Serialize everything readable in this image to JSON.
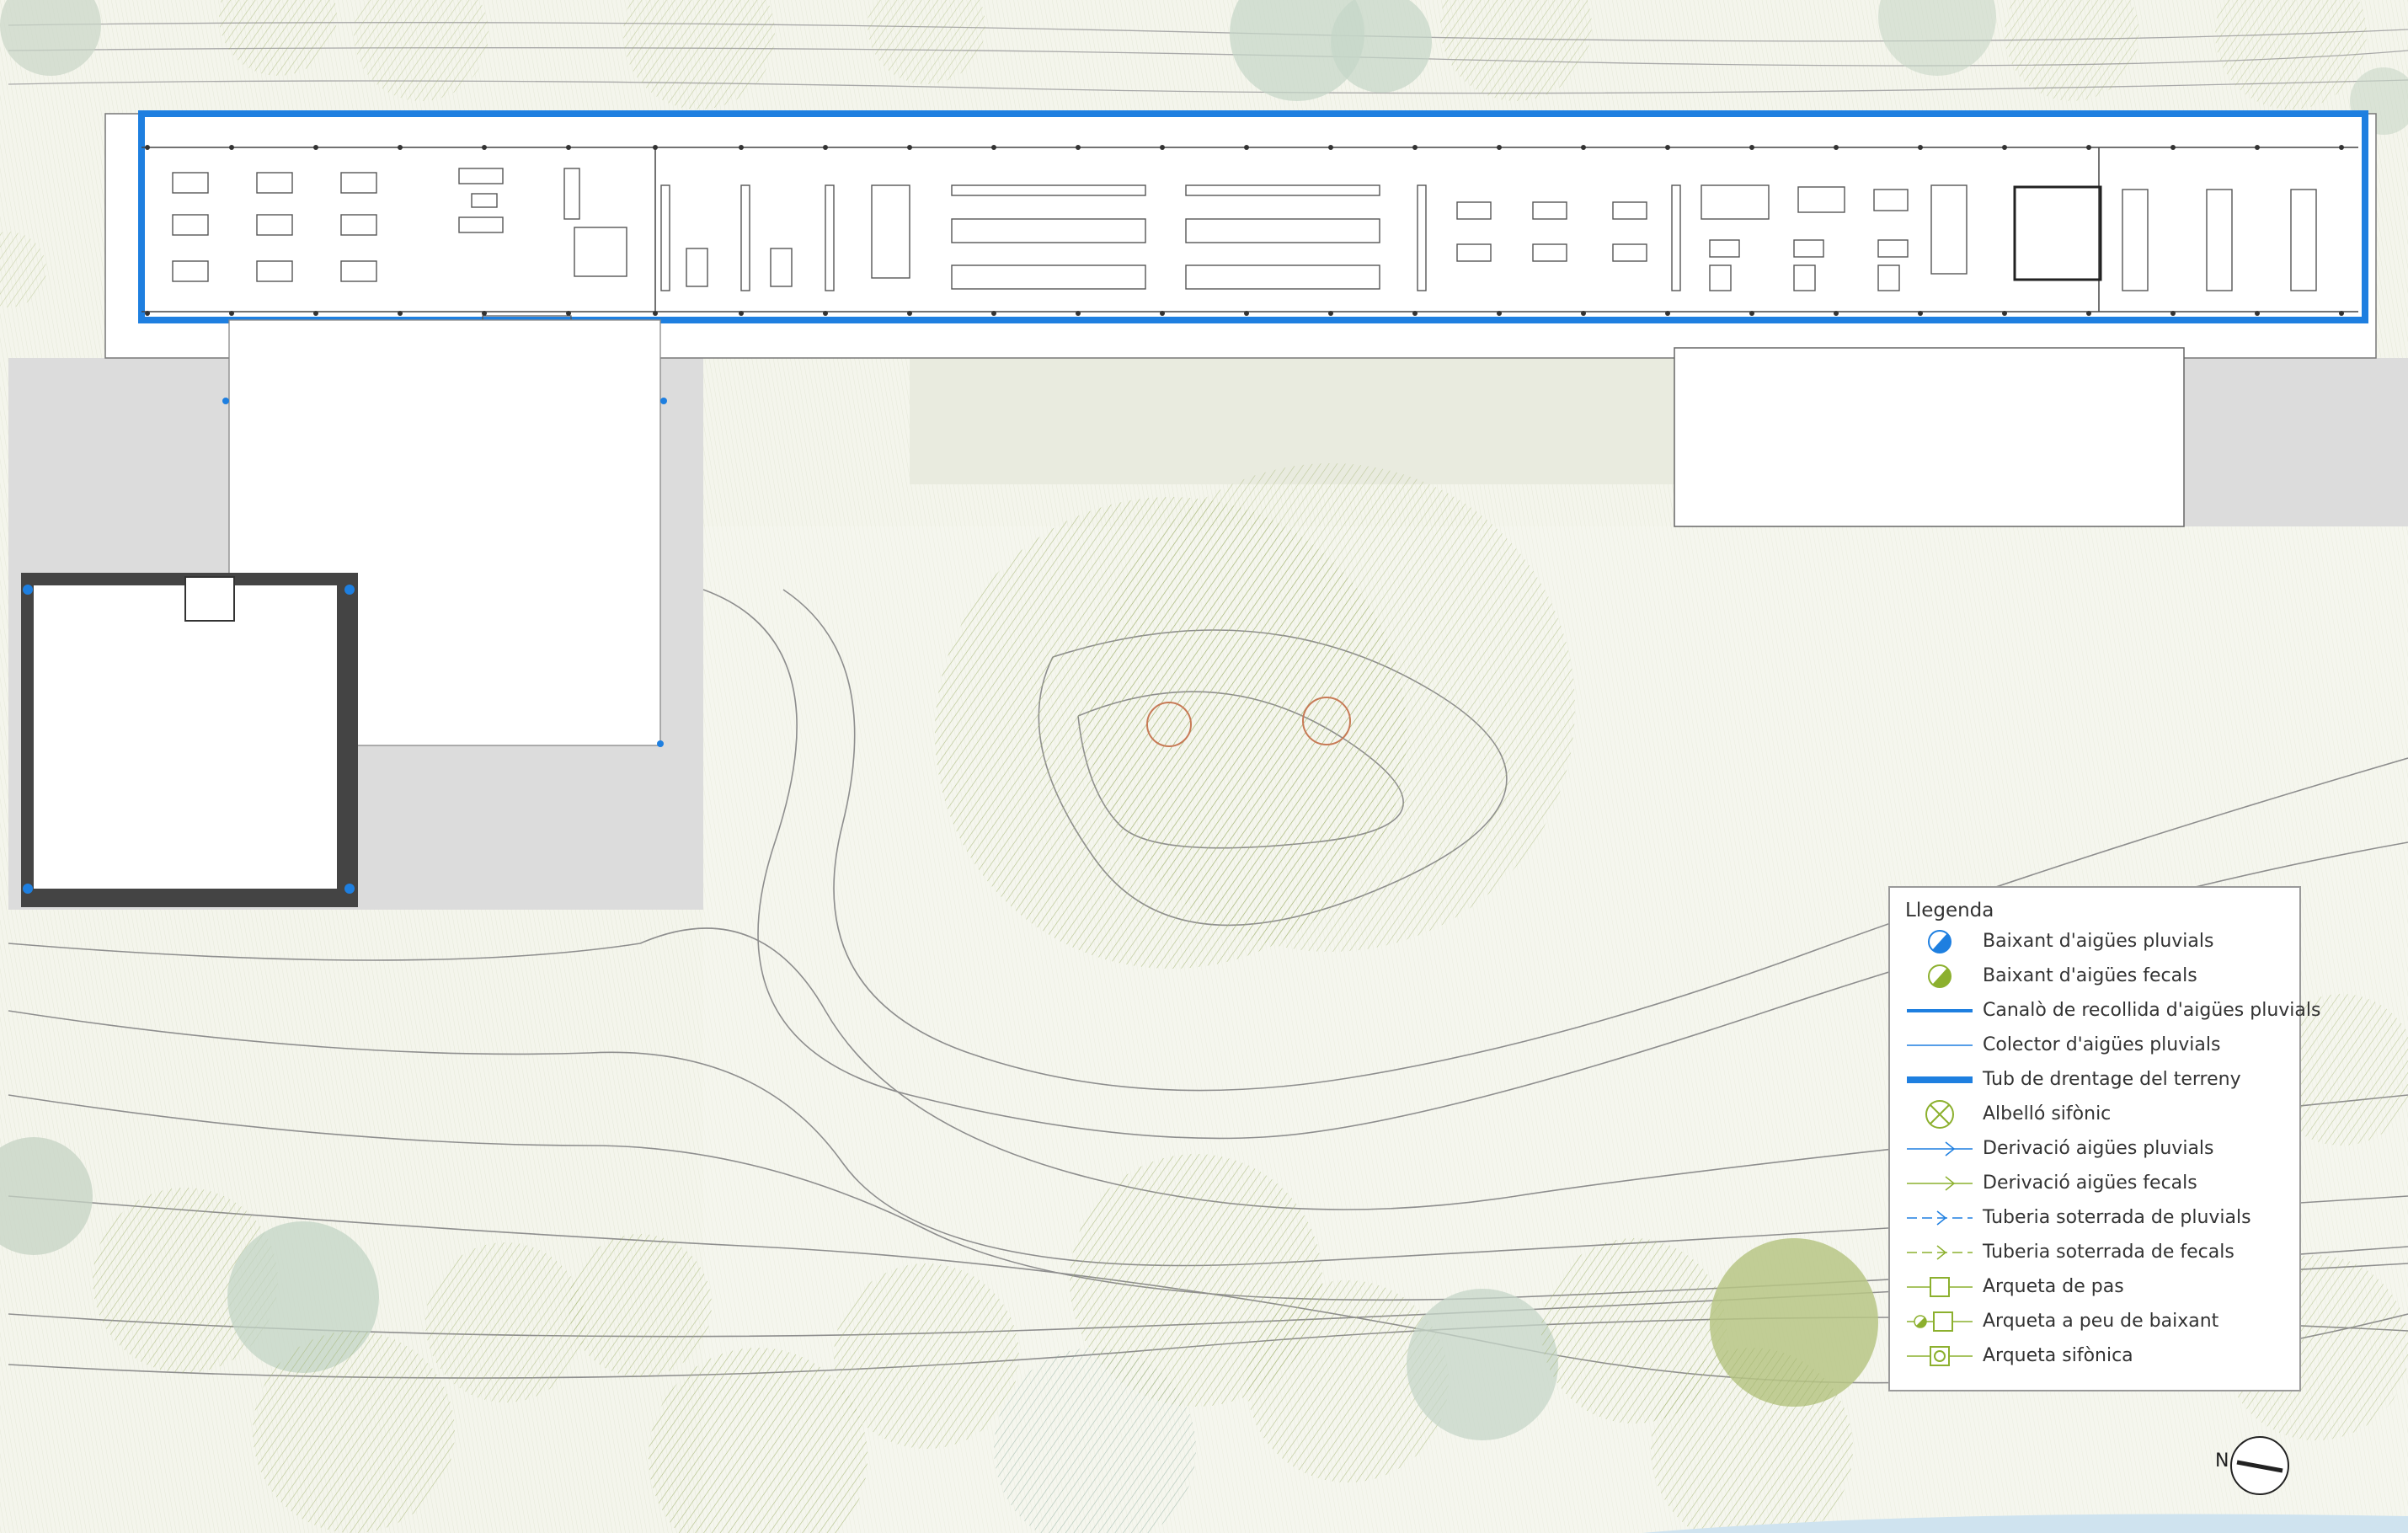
{
  "colors": {
    "pluvial_blue": "#1e7fe0",
    "fecal_green": "#8cb02e",
    "tree_green": "#b7c28c",
    "tree_teal": "#a9bfb2",
    "paving_gray": "#d9d9d9",
    "contour_gray": "#9a9a9a"
  },
  "legend": {
    "title": "Llegenda",
    "items": [
      {
        "icon": "pluvial-downpipe-icon",
        "label": "Baixant d'aigües pluvials"
      },
      {
        "icon": "fecal-downpipe-icon",
        "label": "Baixant d'aigües fecals"
      },
      {
        "icon": "gutter-line-icon",
        "label": "Canalò de recollida d'aigües pluvials"
      },
      {
        "icon": "collector-line-icon",
        "label": "Colector d'aigües pluvials"
      },
      {
        "icon": "drainage-pipe-icon",
        "label": "Tub de drentage del terreny"
      },
      {
        "icon": "siphon-drain-icon",
        "label": "Albelló sifònic"
      },
      {
        "icon": "pluvial-branch-icon",
        "label": "Derivació aigües pluvials"
      },
      {
        "icon": "fecal-branch-icon",
        "label": "Derivació aigües fecals"
      },
      {
        "icon": "buried-pluvial-pipe-icon",
        "label": "Tuberia soterrada de pluvials"
      },
      {
        "icon": "buried-fecal-pipe-icon",
        "label": "Tuberia soterrada de fecals"
      },
      {
        "icon": "pass-manhole-icon",
        "label": "Arqueta de pas"
      },
      {
        "icon": "downpipe-manhole-icon",
        "label": "Arqueta a peu de baixant"
      },
      {
        "icon": "siphon-manhole-icon",
        "label": "Arqueta sifònica"
      }
    ]
  },
  "north_arrow": {
    "label": "N"
  }
}
